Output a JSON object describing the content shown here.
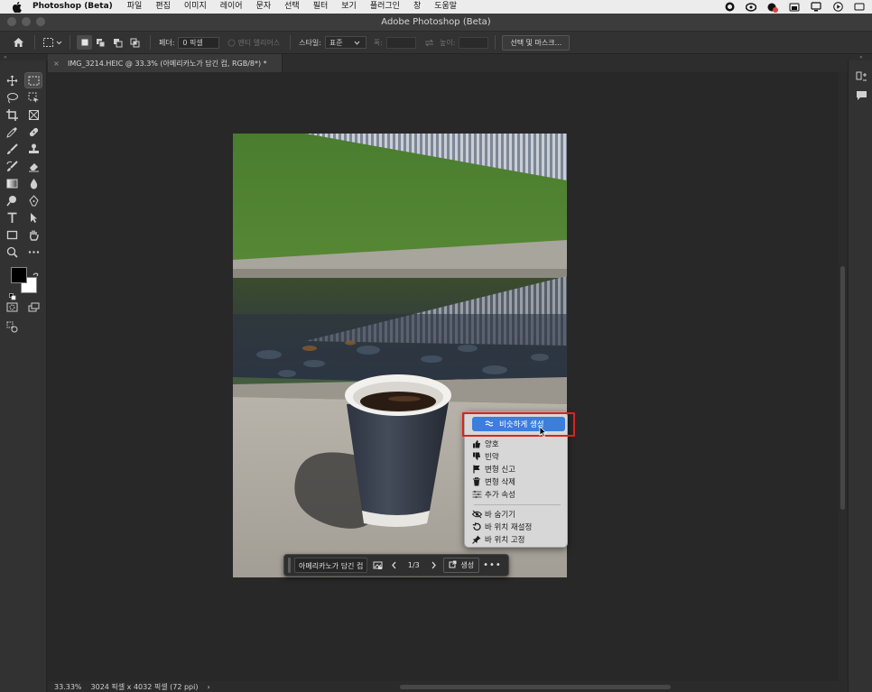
{
  "menubar": {
    "app_name": "Photoshop (Beta)",
    "items": [
      "파일",
      "편집",
      "이미지",
      "레이어",
      "문자",
      "선택",
      "필터",
      "보기",
      "플러그인",
      "창",
      "도움말"
    ]
  },
  "window": {
    "title": "Adobe Photoshop (Beta)"
  },
  "options_bar": {
    "feather_label": "페더:",
    "feather_value": "0 픽셀",
    "antialias_label": "앤티 앨리어스",
    "style_label": "스타일:",
    "style_value": "표준",
    "width_label": "폭:",
    "height_label": "높이:",
    "select_mask_label": "선택 및 마스크..."
  },
  "document": {
    "tab_title": "IMG_3214.HEIC @ 33.3% (아메리카노가 담긴 컵, RGB/8*) *",
    "tab_close": "×"
  },
  "status": {
    "zoom": "33.33%",
    "doc_info": "3024 픽셀 x 4032 픽셀 (72 ppi)",
    "arrow": "›"
  },
  "taskbar": {
    "prompt": "아메리카노가 담긴 컵",
    "counter": "1/3",
    "generate_label": "생성",
    "more": "•••"
  },
  "context_menu": {
    "highlight_label": "비슷하게 생성",
    "items": [
      "양호",
      "빈약",
      "변형 신고",
      "변형 삭제",
      "추가 속성"
    ],
    "items2": [
      "바 숨기기",
      "바 위치 재설정",
      "바 위치 고정"
    ]
  },
  "colors": {
    "highlight": "#3d7ddc",
    "annotation_box": "#e02020",
    "foreground_swatch": "#000000",
    "background_swatch": "#ffffff"
  }
}
